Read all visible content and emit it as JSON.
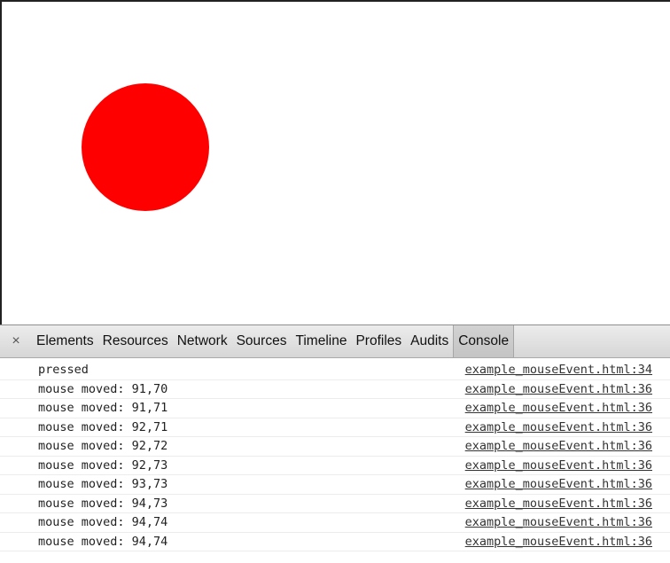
{
  "colors": {
    "circle": "#ff0000"
  },
  "devtools": {
    "close_icon": "×",
    "tabs": [
      {
        "label": "Elements"
      },
      {
        "label": "Resources"
      },
      {
        "label": "Network"
      },
      {
        "label": "Sources"
      },
      {
        "label": "Timeline"
      },
      {
        "label": "Profiles"
      },
      {
        "label": "Audits"
      },
      {
        "label": "Console",
        "active": true
      }
    ]
  },
  "console": {
    "rows": [
      {
        "message": "pressed",
        "source": "example_mouseEvent.html:34"
      },
      {
        "message": "mouse moved: 91,70",
        "source": "example_mouseEvent.html:36"
      },
      {
        "message": "mouse moved: 91,71",
        "source": "example_mouseEvent.html:36"
      },
      {
        "message": "mouse moved: 92,71",
        "source": "example_mouseEvent.html:36"
      },
      {
        "message": "mouse moved: 92,72",
        "source": "example_mouseEvent.html:36"
      },
      {
        "message": "mouse moved: 92,73",
        "source": "example_mouseEvent.html:36"
      },
      {
        "message": "mouse moved: 93,73",
        "source": "example_mouseEvent.html:36"
      },
      {
        "message": "mouse moved: 94,73",
        "source": "example_mouseEvent.html:36"
      },
      {
        "message": "mouse moved: 94,74",
        "source": "example_mouseEvent.html:36"
      },
      {
        "message": "mouse moved: 94,74",
        "source": "example_mouseEvent.html:36"
      }
    ]
  }
}
